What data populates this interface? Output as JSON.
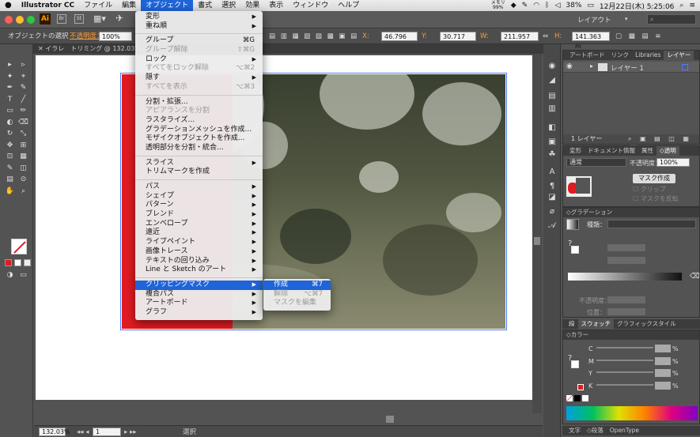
{
  "menubar": {
    "app": "Illustrator CC",
    "items": [
      "ファイル",
      "編集",
      "オブジェクト",
      "書式",
      "選択",
      "効果",
      "表示",
      "ウィンドウ",
      "ヘルプ"
    ],
    "active_index": 2,
    "status": {
      "battery": "38%",
      "datetime": "12月22日(木) 5:25:06",
      "memory": "メモリ\n99%"
    }
  },
  "titlebar": {
    "workspace": "レイアウト",
    "search_icon": "search-icon"
  },
  "ctrl": {
    "object_label": "オブジェクトの選択",
    "opacity_label": "不透明度：",
    "opacity_value": "100%",
    "x_label": "X:",
    "x_value": "46.796 mm",
    "y_label": "Y:",
    "y_value": "30.717 mm",
    "w_label": "W:",
    "w_value": "211.957 mm",
    "h_label": "H:",
    "h_value": "141.363 m"
  },
  "doctab": {
    "title": "イラレ　トリミング @ 132.03% ("
  },
  "bottom": {
    "zoom": "132.03%",
    "page": "1",
    "status": "選択"
  },
  "object_menu": {
    "items": [
      {
        "label": "変形",
        "arrow": true
      },
      {
        "label": "重ね順",
        "arrow": true
      },
      {
        "sep": true
      },
      {
        "label": "グループ",
        "shortcut": "⌘G"
      },
      {
        "label": "グループ解除",
        "shortcut": "⇧⌘G",
        "disabled": true
      },
      {
        "label": "ロック",
        "arrow": true
      },
      {
        "label": "すべてをロック解除",
        "shortcut": "⌥⌘2",
        "disabled": true
      },
      {
        "label": "隠す",
        "arrow": true
      },
      {
        "label": "すべてを表示",
        "shortcut": "⌥⌘3",
        "disabled": true
      },
      {
        "sep": true
      },
      {
        "label": "分割・拡張..."
      },
      {
        "label": "アピアランスを分割",
        "disabled": true
      },
      {
        "label": "ラスタライズ..."
      },
      {
        "label": "グラデーションメッシュを作成..."
      },
      {
        "label": "モザイクオブジェクトを作成..."
      },
      {
        "label": "透明部分を分割・統合..."
      },
      {
        "sep": true
      },
      {
        "label": "スライス",
        "arrow": true
      },
      {
        "label": "トリムマークを作成"
      },
      {
        "sep": true
      },
      {
        "label": "パス",
        "arrow": true
      },
      {
        "label": "シェイプ",
        "arrow": true
      },
      {
        "label": "パターン",
        "arrow": true
      },
      {
        "label": "ブレンド",
        "arrow": true
      },
      {
        "label": "エンベロープ",
        "arrow": true
      },
      {
        "label": "遠近",
        "arrow": true
      },
      {
        "label": "ライブペイント",
        "arrow": true
      },
      {
        "label": "画像トレース",
        "arrow": true
      },
      {
        "label": "テキストの回り込み",
        "arrow": true
      },
      {
        "label": "Line と Sketch のアート",
        "arrow": true
      },
      {
        "sep": true
      },
      {
        "label": "クリッピングマスク",
        "arrow": true,
        "highlighted": true
      },
      {
        "label": "複合パス",
        "arrow": true
      },
      {
        "label": "アートボード",
        "arrow": true
      },
      {
        "label": "グラフ",
        "arrow": true
      }
    ]
  },
  "clip_submenu": {
    "items": [
      {
        "label": "作成",
        "shortcut": "⌘7",
        "highlighted": true
      },
      {
        "label": "解除",
        "shortcut": "⌥⌘7",
        "disabled": true
      },
      {
        "label": "マスクを編集",
        "disabled": true
      }
    ]
  },
  "layers_panel": {
    "tabs": [
      "アートボード",
      "リンク",
      "Libraries",
      "レイヤー"
    ],
    "active": 3,
    "layer_name": "レイヤー 1",
    "footer": "1 レイヤー"
  },
  "transparency_panel": {
    "tabs": [
      "変形",
      "ドキュメント情報",
      "属性",
      "◇透明"
    ],
    "mode": "通常",
    "opacity_label": "不透明度：",
    "opacity_value": "100%",
    "make_mask": "マスク作成",
    "clip": "クリップ",
    "invert": "マスクを反転"
  },
  "gradient_panel": {
    "title": "◇グラデーション",
    "type_label": "種類：",
    "opacity_label": "不透明度：",
    "position_label": "位置："
  },
  "swatch_tabs": {
    "tabs": [
      "線",
      "スウォッチ",
      "グラフィックスタイル"
    ],
    "active": 1
  },
  "color_panel": {
    "title": "◇カラー",
    "channels": [
      {
        "label": "C",
        "unit": "%"
      },
      {
        "label": "M",
        "unit": "%"
      },
      {
        "label": "Y",
        "unit": "%"
      },
      {
        "label": "K",
        "unit": "%"
      }
    ]
  },
  "type_tabs": {
    "tabs": [
      "文字",
      "◇段落",
      "OpenType"
    ]
  },
  "colors": {
    "accent": "#1f64d8",
    "mask_red": "#e11b22"
  }
}
